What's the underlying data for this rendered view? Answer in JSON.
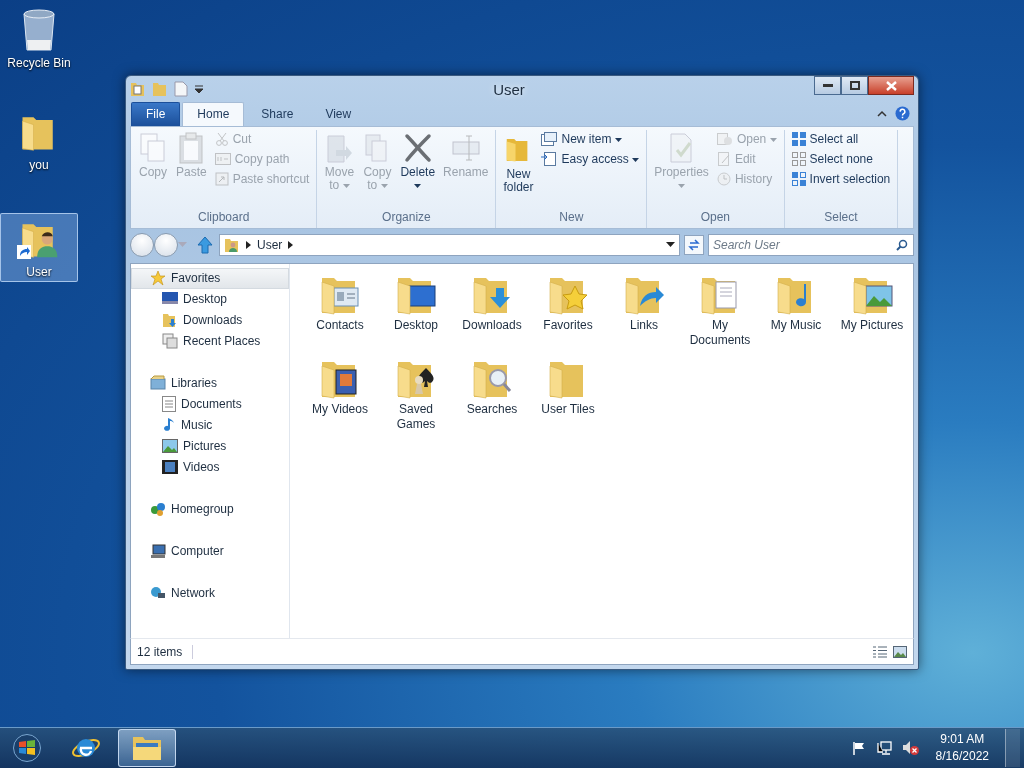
{
  "desktop_icons": [
    {
      "label": "Recycle Bin",
      "selected": false
    },
    {
      "label": "you",
      "selected": false
    },
    {
      "label": "User",
      "selected": true
    }
  ],
  "window": {
    "title": "User",
    "ribbon_tabs": [
      {
        "label": "File",
        "kind": "file",
        "selected": false
      },
      {
        "label": "Home",
        "kind": "tab",
        "selected": true
      },
      {
        "label": "Share",
        "kind": "tab",
        "selected": false
      },
      {
        "label": "View",
        "kind": "tab",
        "selected": false
      }
    ],
    "ribbon_groups": [
      {
        "label": "Clipboard",
        "items": [
          {
            "label": "Copy",
            "kind": "large",
            "disabled": true,
            "dropdown": false
          },
          {
            "label": "Paste",
            "kind": "large",
            "disabled": true,
            "dropdown": false
          },
          {
            "label": "Cut",
            "kind": "small",
            "disabled": true,
            "dropdown": false
          },
          {
            "label": "Copy path",
            "kind": "small",
            "disabled": true,
            "dropdown": false
          },
          {
            "label": "Paste shortcut",
            "kind": "small",
            "disabled": true,
            "dropdown": false
          }
        ]
      },
      {
        "label": "Organize",
        "items": [
          {
            "label": "Move to",
            "kind": "large",
            "disabled": true,
            "dropdown": true
          },
          {
            "label": "Copy to",
            "kind": "large",
            "disabled": true,
            "dropdown": true
          },
          {
            "label": "Delete",
            "kind": "large",
            "disabled": false,
            "dropdown": true
          },
          {
            "label": "Rename",
            "kind": "large",
            "disabled": true,
            "dropdown": false
          }
        ]
      },
      {
        "label": "New",
        "items": [
          {
            "label": "New folder",
            "kind": "large",
            "disabled": false,
            "dropdown": false
          },
          {
            "label": "New item",
            "kind": "small",
            "disabled": false,
            "dropdown": true
          },
          {
            "label": "Easy access",
            "kind": "small",
            "disabled": false,
            "dropdown": true
          }
        ]
      },
      {
        "label": "Open",
        "items": [
          {
            "label": "Properties",
            "kind": "large",
            "disabled": true,
            "dropdown": true
          },
          {
            "label": "Open",
            "kind": "small",
            "disabled": true,
            "dropdown": true
          },
          {
            "label": "Edit",
            "kind": "small",
            "disabled": true,
            "dropdown": false
          },
          {
            "label": "History",
            "kind": "small",
            "disabled": true,
            "dropdown": false
          }
        ]
      },
      {
        "label": "Select",
        "items": [
          {
            "label": "Select all",
            "kind": "small",
            "disabled": false,
            "dropdown": false
          },
          {
            "label": "Select none",
            "kind": "small",
            "disabled": false,
            "dropdown": false
          },
          {
            "label": "Invert selection",
            "kind": "small",
            "disabled": false,
            "dropdown": false
          }
        ]
      }
    ],
    "address_path": [
      "User"
    ],
    "search": {
      "placeholder": "Search User"
    },
    "nav_sections": [
      {
        "label": "Favorites",
        "selected": true,
        "children": [
          {
            "label": "Desktop",
            "selected": false
          },
          {
            "label": "Downloads",
            "selected": false
          },
          {
            "label": "Recent Places",
            "selected": false
          }
        ]
      },
      {
        "label": "Libraries",
        "selected": false,
        "children": [
          {
            "label": "Documents",
            "selected": false
          },
          {
            "label": "Music",
            "selected": false
          },
          {
            "label": "Pictures",
            "selected": false
          },
          {
            "label": "Videos",
            "selected": false
          }
        ]
      },
      {
        "label": "Homegroup",
        "selected": false
      },
      {
        "label": "Computer",
        "selected": false
      },
      {
        "label": "Network",
        "selected": false
      }
    ],
    "items": [
      {
        "label": "Contacts"
      },
      {
        "label": "Desktop"
      },
      {
        "label": "Downloads"
      },
      {
        "label": "Favorites"
      },
      {
        "label": "Links"
      },
      {
        "label": "My Documents"
      },
      {
        "label": "My Music"
      },
      {
        "label": "My Pictures"
      },
      {
        "label": "My Videos"
      },
      {
        "label": "Saved Games"
      },
      {
        "label": "Searches"
      },
      {
        "label": "User Tiles"
      }
    ],
    "status_bar": {
      "item_count": "12 items"
    }
  },
  "taskbar": {
    "buttons": [
      {
        "kind": "start",
        "selected": false
      },
      {
        "kind": "browser",
        "selected": false
      },
      {
        "kind": "explorer",
        "selected": true
      }
    ],
    "time": "9:01 AM",
    "date": "8/16/2022"
  }
}
